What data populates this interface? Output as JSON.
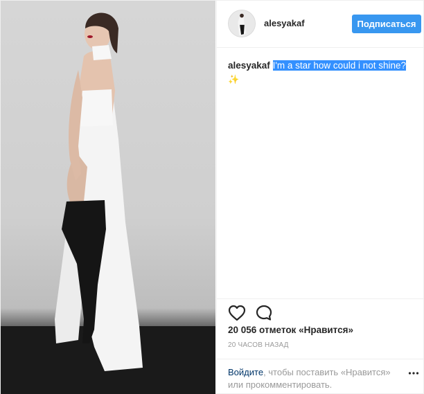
{
  "post": {
    "author": "alesyakaf",
    "follow_label": "Подписаться",
    "caption_user": "alesyakaf",
    "caption_text": "I'm a star how could i not shine?",
    "caption_emoji": "✨",
    "likes": "20 056 отметок «Нравится»",
    "timestamp": "20 ЧАСОВ НАЗАД",
    "login_link": "Войдите",
    "login_text": ", чтобы поставить «Нравится» или прокомментировать."
  },
  "icons": {
    "like": "heart-icon",
    "comment": "comment-icon",
    "more": "more-options-icon"
  },
  "colors": {
    "accent": "#3897f0",
    "selection": "#3390ff",
    "muted": "#999999",
    "link": "#003569"
  }
}
